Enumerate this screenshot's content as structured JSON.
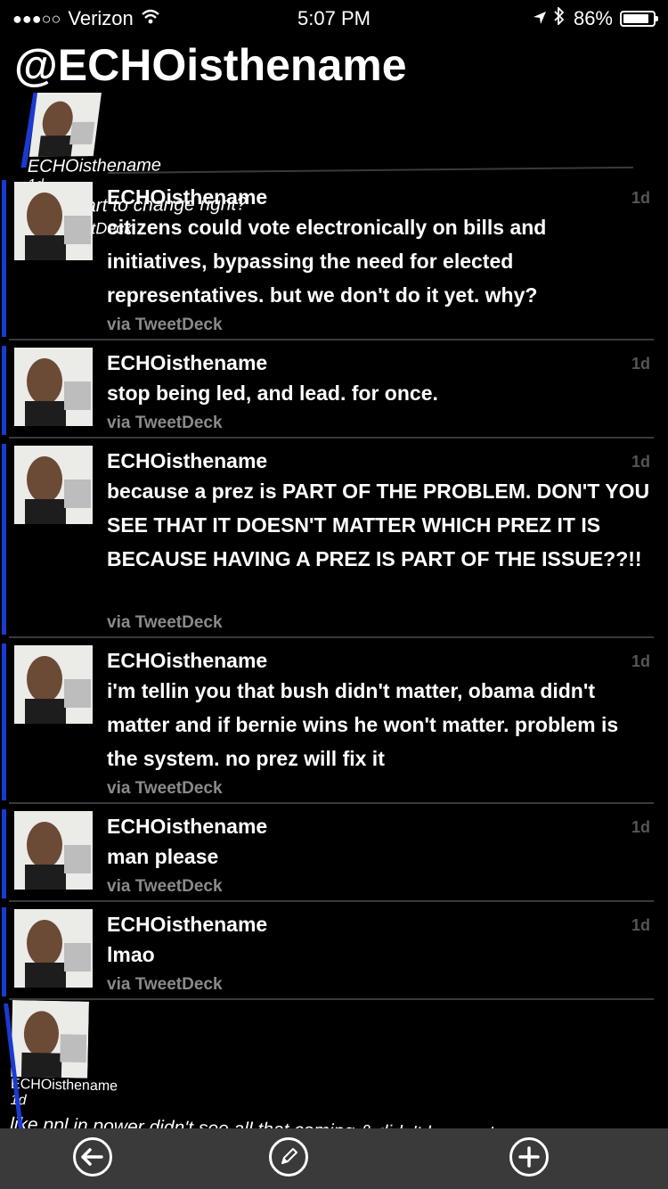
{
  "status": {
    "carrier": "Verizon",
    "signal_dots": "●●●○○",
    "time": "5:07 PM",
    "battery": "86%",
    "battery_level": 0.86
  },
  "header": {
    "title": "@ECHOisthename"
  },
  "tweets": [
    {
      "name": "ECHOisthename",
      "time": "1d",
      "text": "it's a start to change right?",
      "via": "via TweetDeck"
    },
    {
      "name": "ECHOisthename",
      "time": "1d",
      "text": "citizens could vote electronically on bills and initiatives, bypassing the need for elected representatives. but we don't do it yet. why?",
      "via": "via TweetDeck"
    },
    {
      "name": "ECHOisthename",
      "time": "1d",
      "text": "stop being led, and lead. for once.",
      "via": "via TweetDeck"
    },
    {
      "name": "ECHOisthename",
      "time": "1d",
      "text": "because a prez is PART OF THE PROBLEM. DON'T YOU SEE THAT IT DOESN'T MATTER WHICH PREZ IT IS BECAUSE HAVING A PREZ IS PART OF THE ISSUE??!!",
      "via": "via TweetDeck"
    },
    {
      "name": "ECHOisthename",
      "time": "1d",
      "text": "i'm tellin you that bush didn't matter, obama didn't matter and if bernie wins he won't matter. problem is the system. no prez will fix it",
      "via": "via TweetDeck"
    },
    {
      "name": "ECHOisthename",
      "time": "1d",
      "text": "man please",
      "via": "via TweetDeck"
    },
    {
      "name": "ECHOisthename",
      "time": "1d",
      "text": "lmao",
      "via": "via TweetDeck"
    },
    {
      "name": "ECHOisthename",
      "time": "1d",
      "text": "like ppl in power didn't see all that coming & didn't know who was gonna benefit or die, and didn't have plans in place to keep us afloat?",
      "via": ""
    }
  ],
  "toolbar": {
    "back_icon": "back-arrow-icon",
    "compose_icon": "pencil-icon",
    "add_icon": "plus-icon"
  },
  "colors": {
    "accent_bar": "#1a3bd1",
    "background": "#000000",
    "toolbar": "#3a3a3a"
  }
}
